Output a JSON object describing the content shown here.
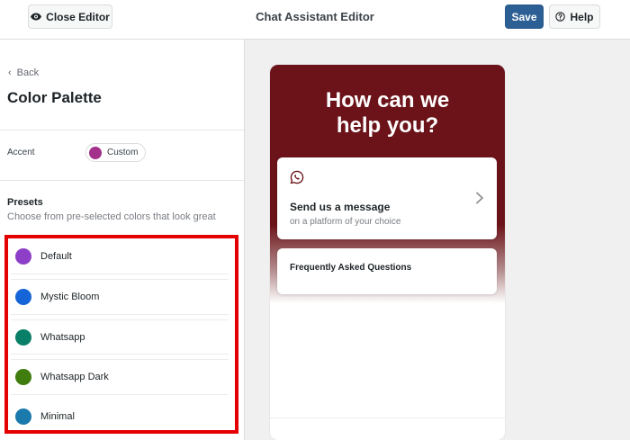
{
  "topbar": {
    "close_label": "Close Editor",
    "title": "Chat Assistant Editor",
    "save_label": "Save",
    "help_label": "Help"
  },
  "sidebar": {
    "back_label": "Back",
    "section_title": "Color Palette",
    "accent": {
      "label": "Accent",
      "value": "Custom",
      "color": "#a3308b"
    },
    "presets": {
      "label": "Presets",
      "description": "Choose from pre-selected colors that look great",
      "items": [
        {
          "label": "Default",
          "color": "#8e3fc7"
        },
        {
          "label": "Mystic Bloom",
          "color": "#1565d8"
        },
        {
          "label": "Whatsapp",
          "color": "#0a7f67"
        },
        {
          "label": "Whatsapp Dark",
          "color": "#3e7d0e"
        },
        {
          "label": "Minimal",
          "color": "#1a7aac"
        }
      ]
    }
  },
  "preview": {
    "title": "How can we help you?",
    "header_color": "#6b1319",
    "message_card": {
      "title": "Send us a message",
      "subtitle": "on a platform of your choice",
      "icon": "whatsapp-icon"
    },
    "faq_card": {
      "title": "Frequently Asked Questions"
    }
  }
}
